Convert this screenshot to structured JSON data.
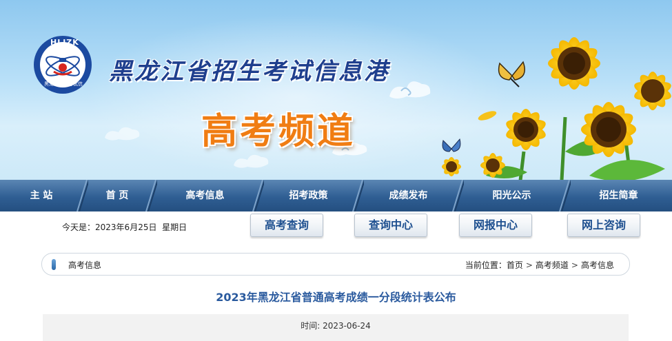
{
  "site": {
    "logo_text": "HLJZK",
    "logo_ring_text": "黑龙江招生考试信息港",
    "name": "黑龙江省招生考试信息港",
    "channel": "高考频道"
  },
  "nav": {
    "items": [
      {
        "label": "主 站"
      },
      {
        "label": "首 页"
      },
      {
        "label": "高考信息"
      },
      {
        "label": "招考政策"
      },
      {
        "label": "成绩发布"
      },
      {
        "label": "阳光公示"
      },
      {
        "label": "招生简章"
      }
    ]
  },
  "toolbar": {
    "today_label": "今天是：",
    "today_value": "2023年6月25日  星期日",
    "buttons": [
      {
        "label": "高考查询"
      },
      {
        "label": "查询中心"
      },
      {
        "label": "网报中心"
      },
      {
        "label": "网上咨询"
      }
    ]
  },
  "breadcrumb": {
    "section": "高考信息",
    "location_label": "当前位置：",
    "path": [
      "首页",
      "高考频道",
      "高考信息"
    ],
    "separator": ">"
  },
  "article": {
    "title": "2023年黑龙江省普通高考成绩一分段统计表公布",
    "time_label": "时间:",
    "time_value": "2023-06-24"
  },
  "colors": {
    "nav_bg": "#2f5e93",
    "title_blue": "#2a5a9e",
    "channel_orange": "#f07d13",
    "site_name_blue": "#1f3f8e"
  }
}
